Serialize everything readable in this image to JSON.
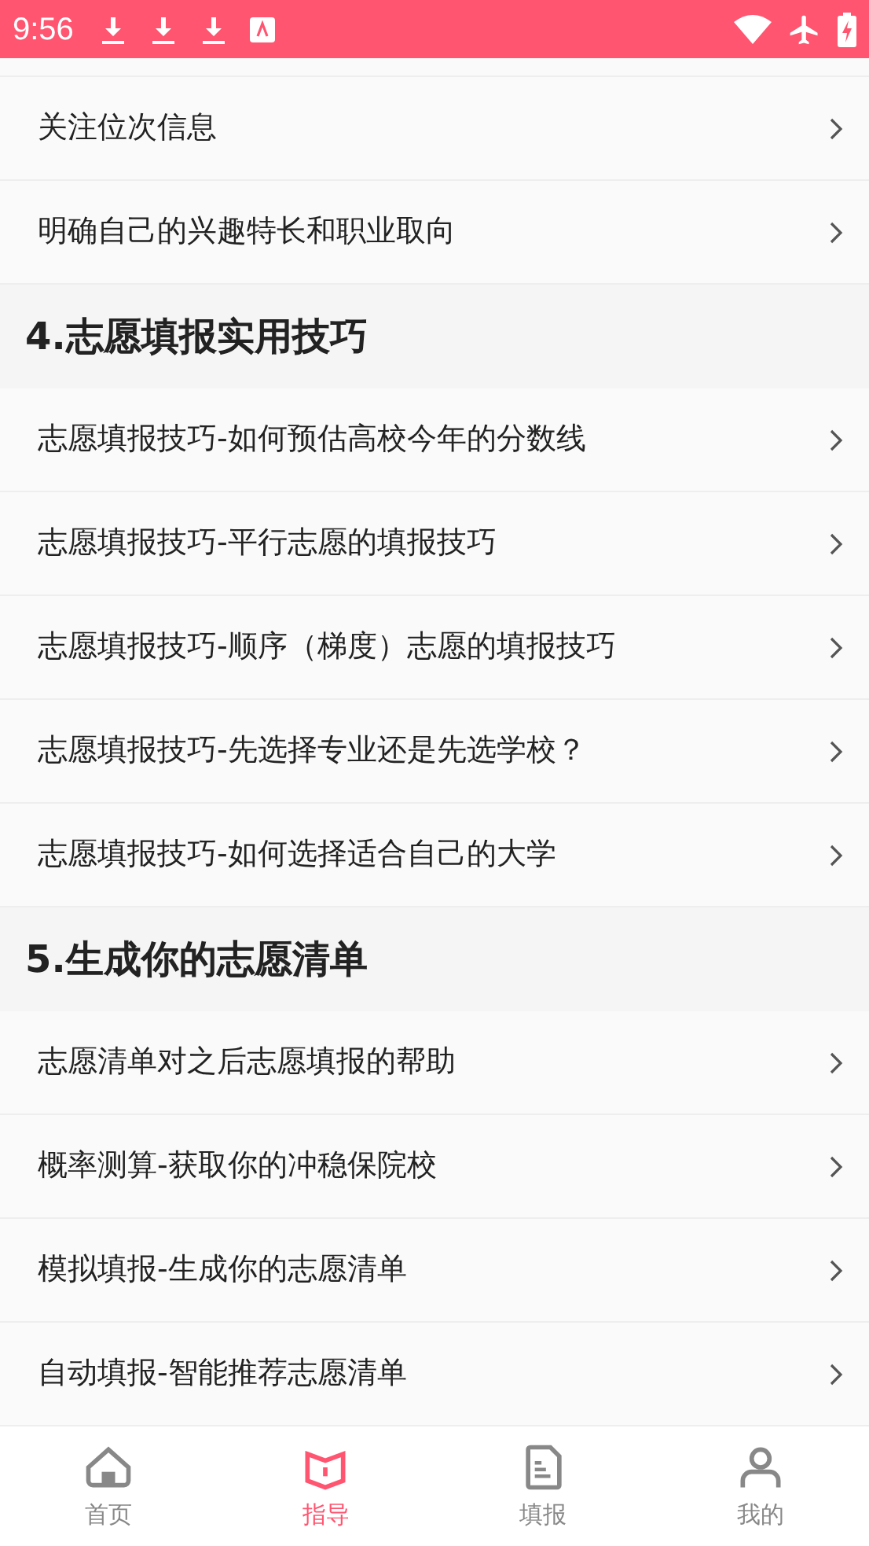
{
  "status_bar": {
    "time": "9:56"
  },
  "sections": [
    {
      "items": [
        "关注位次信息",
        "明确自己的兴趣特长和职业取向"
      ]
    },
    {
      "title": "4.志愿填报实用技巧",
      "items": [
        "志愿填报技巧-如何预估高校今年的分数线",
        "志愿填报技巧-平行志愿的填报技巧",
        "志愿填报技巧-顺序（梯度）志愿的填报技巧",
        "志愿填报技巧-先选择专业还是先选学校？",
        "志愿填报技巧-如何选择适合自己的大学"
      ]
    },
    {
      "title": "5.生成你的志愿清单",
      "items": [
        "志愿清单对之后志愿填报的帮助",
        "概率测算-获取你的冲稳保院校",
        "模拟填报-生成你的志愿清单",
        "自动填报-智能推荐志愿清单"
      ]
    }
  ],
  "nav": [
    {
      "kind": "home",
      "label": "首页",
      "selected": false
    },
    {
      "kind": "guide",
      "label": "指导",
      "selected": true
    },
    {
      "kind": "form",
      "label": "填报",
      "selected": false
    },
    {
      "kind": "me",
      "label": "我的",
      "selected": false
    }
  ]
}
